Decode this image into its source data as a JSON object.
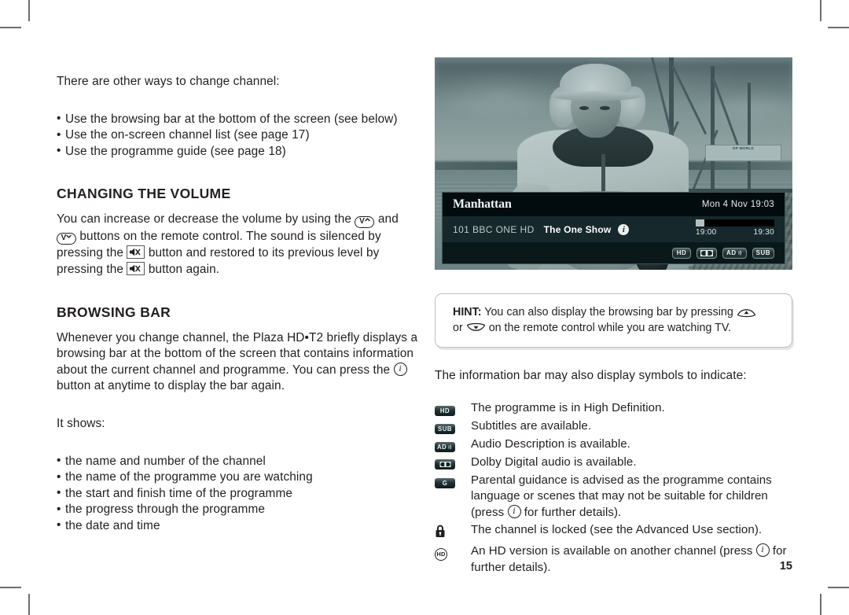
{
  "page": {
    "number": "15"
  },
  "left_column": {
    "intro": "There are other ways to change channel:",
    "intro_bullets": [
      "Use the browsing bar at the bottom of the screen (see below)",
      "Use the on-screen channel list (see page 17)",
      "Use the programme guide (see page 18)"
    ],
    "volume": {
      "heading": "CHANGING THE VOLUME",
      "text_1": "You can increase or decrease the volume by using the",
      "key_vol_up": "V",
      "text_2": "and",
      "key_vol_down": "V",
      "text_3": "buttons on the remote control. The sound is silenced by pressing the",
      "text_4": "button and restored to its previous level by pressing the",
      "text_5": "button again."
    },
    "browsing": {
      "heading": "BROWSING BAR",
      "text_1": "Whenever you change channel, the Plaza HD•T2 briefly displays a browsing bar at the bottom of the screen that contains information about the current channel and programme. You can press the",
      "text_2": "button at anytime to display the bar again.",
      "it_shows": "It shows:",
      "shows_bullets": [
        "the name and number of the channel",
        "the name of the programme you are watching",
        "the start and finish time of the programme",
        "the progress through the programme",
        "the date and time"
      ]
    }
  },
  "tv": {
    "browsing_bar": {
      "brand": "Manhattan",
      "datetime": "Mon 4 Nov 19:03",
      "channel": "101 BBC ONE HD",
      "programme": "The One Show",
      "info_glyph": "i",
      "start_time": "19:00",
      "end_time": "19:30",
      "badges": [
        "HD",
        "▮◀▶▮",
        "AD·»",
        "SUB"
      ],
      "badge_hd": "HD",
      "badge_dolby": "DD",
      "badge_ad": "AD",
      "badge_sub": "SUB"
    },
    "photo": {
      "sign_text": "DP WORLD"
    }
  },
  "hint": {
    "label": "HINT:",
    "text_1": "You can also display the browsing bar by pressing",
    "text_2": "or",
    "text_3": "on the remote control while you are watching TV."
  },
  "symbols": {
    "intro": "The information bar may also display symbols to indicate:",
    "rows": [
      {
        "icon": "hd-badge-icon",
        "badge": "HD",
        "text": "The programme is in High Definition."
      },
      {
        "icon": "sub-badge-icon",
        "badge": "SUB",
        "text": "Subtitles are available."
      },
      {
        "icon": "audio-description-badge-icon",
        "badge": "AD",
        "text": "Audio Description is available."
      },
      {
        "icon": "dolby-digital-badge-icon",
        "badge": "DD",
        "text": "Dolby Digital audio is available."
      },
      {
        "icon": "parental-guidance-badge-icon",
        "badge": "G",
        "text_a": "Parental guidance is advised as the programme contains language or scenes that may not be suitable for children (press",
        "text_b": "for further details)."
      },
      {
        "icon": "lock-icon",
        "badge": "",
        "text": "The channel is locked (see the Advanced Use section)."
      },
      {
        "icon": "hd-circle-icon",
        "badge": "HD",
        "text_a": "An HD version is available on another channel (press",
        "text_b": "for further details)."
      }
    ]
  },
  "colors": {
    "ink": "#231f20",
    "crop_mark": "#6d6e71",
    "hint_border": "#bcbec0",
    "bar_top": "#020b0d",
    "bar_mid": "#16282b",
    "bar_bottom": "#0b181a"
  }
}
